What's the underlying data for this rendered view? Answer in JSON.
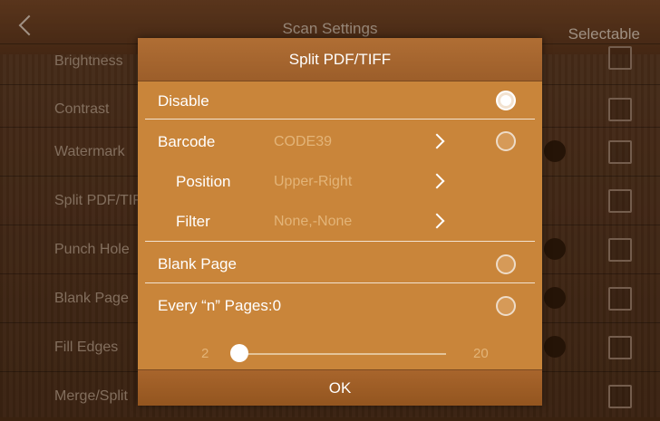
{
  "background": {
    "title": "Scan Settings",
    "selectable_label": "Selectable",
    "rows": [
      {
        "label": "Brightness"
      },
      {
        "label": "Contrast"
      },
      {
        "label": "Watermark"
      },
      {
        "label": "Split PDF/TIFF"
      },
      {
        "label": "Punch Hole"
      },
      {
        "label": "Blank Page"
      },
      {
        "label": "Fill Edges"
      },
      {
        "label": "Merge/Split"
      }
    ]
  },
  "dialog": {
    "title": "Split PDF/TIFF",
    "options": {
      "disable": {
        "label": "Disable",
        "selected": true
      },
      "barcode": {
        "label": "Barcode",
        "value": "CODE39",
        "selected": false
      },
      "position": {
        "label": "Position",
        "value": "Upper-Right"
      },
      "filter": {
        "label": "Filter",
        "value": "None,-None"
      },
      "blank_page": {
        "label": "Blank Page",
        "selected": false
      },
      "every_n": {
        "label": "Every “n” Pages:0",
        "selected": false
      }
    },
    "slider": {
      "min_label": "2",
      "max_label": "20",
      "min": 2,
      "max": 20,
      "value": 2
    },
    "ok_label": "OK"
  },
  "colors": {
    "dialog_bg": "#c9853a",
    "header_bg": "#9c5e2a",
    "text": "#ffffff",
    "value_text": "#e3b478"
  }
}
